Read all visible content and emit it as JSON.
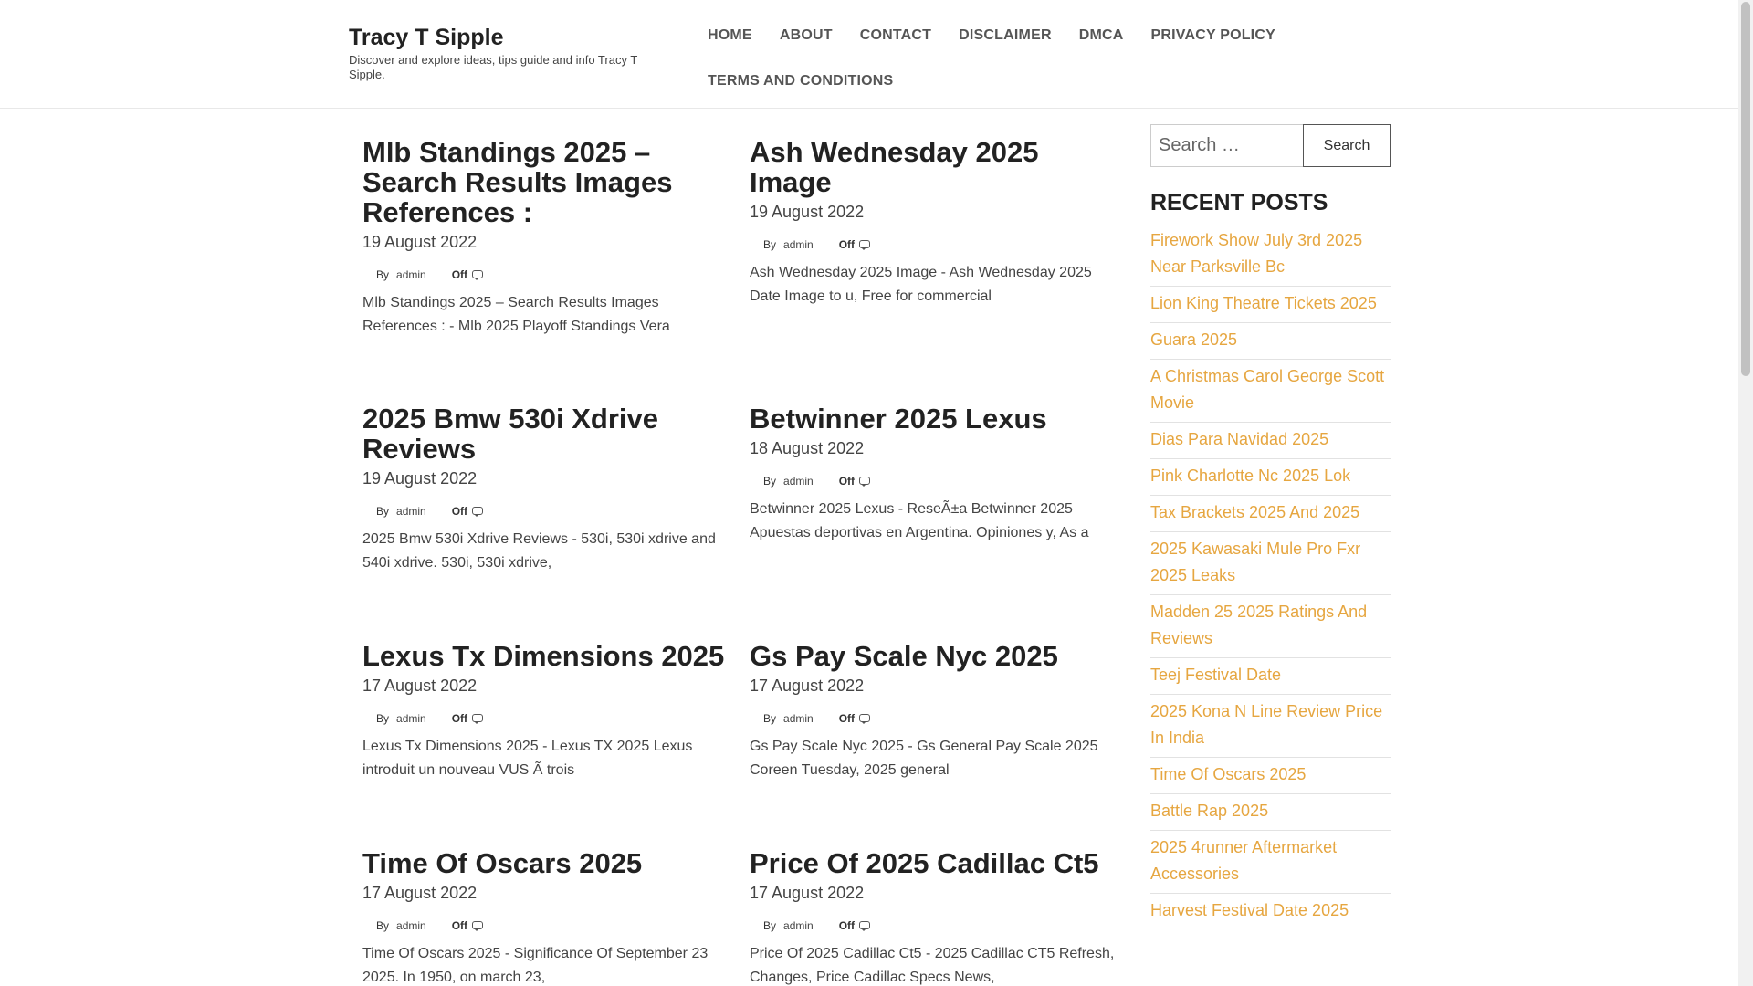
{
  "site": {
    "title": "Tracy T Sipple",
    "description": "Discover and explore ideas, tips guide and info Tracy T Sipple."
  },
  "nav": {
    "items": [
      "HOME",
      "ABOUT",
      "CONTACT",
      "DISCLAIMER",
      "DMCA",
      "PRIVACY POLICY",
      "TERMS AND CONDITIONS"
    ]
  },
  "posts": [
    {
      "title": "Mlb Standings 2025 – Search Results Images References :",
      "date": "19 August 2022",
      "by": "By",
      "author": "admin",
      "comments": "Off",
      "excerpt": "Mlb Standings 2025 – Search Results Images References : - Mlb 2025 Playoff Standings Vera"
    },
    {
      "title": "Ash Wednesday 2025 Image",
      "date": "19 August 2022",
      "by": "By",
      "author": "admin",
      "comments": "Off",
      "excerpt": "Ash Wednesday 2025 Image - Ash Wednesday 2025 Date Image to u, Free for commercial"
    },
    {
      "title": "2025 Bmw 530i Xdrive Reviews",
      "date": "19 August 2022",
      "by": "By",
      "author": "admin",
      "comments": "Off",
      "excerpt": "2025 Bmw 530i Xdrive Reviews - 530i, 530i xdrive and 540i xdrive. 530i, 530i xdrive,"
    },
    {
      "title": "Betwinner 2025 Lexus",
      "date": "18 August 2022",
      "by": "By",
      "author": "admin",
      "comments": "Off",
      "excerpt": "Betwinner 2025 Lexus - ReseÃ±a Betwinner 2025 Apuestas deportivas en Argentina. Opiniones y, As a"
    },
    {
      "title": "Lexus Tx Dimensions 2025",
      "date": "17 August 2022",
      "by": "By",
      "author": "admin",
      "comments": "Off",
      "excerpt": "Lexus Tx Dimensions 2025 - Lexus TX 2025 Lexus introduit un nouveau VUS Ã  trois"
    },
    {
      "title": "Gs Pay Scale Nyc 2025",
      "date": "17 August 2022",
      "by": "By",
      "author": "admin",
      "comments": "Off",
      "excerpt": "Gs Pay Scale Nyc 2025 - Gs General Pay Scale 2025 Coreen Tuesday, 2025 general"
    },
    {
      "title": "Time Of Oscars 2025",
      "date": "17 August 2022",
      "by": "By",
      "author": "admin",
      "comments": "Off",
      "excerpt": "Time Of Oscars 2025 - Significance Of September 23 2025. In 1950, on march 23,"
    },
    {
      "title": "Price Of 2025 Cadillac Ct5",
      "date": "17 August 2022",
      "by": "By",
      "author": "admin",
      "comments": "Off",
      "excerpt": "Price Of 2025 Cadillac Ct5 - 2025 Cadillac CT5 Refresh, Changes, Price Cadillac Specs News,"
    }
  ],
  "sidebar": {
    "search_placeholder": "Search …",
    "search_button": "Search",
    "recent_title": "RECENT POSTS",
    "recent_posts": [
      "Firework Show July 3rd 2025 Near Parksville Bc",
      "Lion King Theatre Tickets 2025",
      "Guara 2025",
      "A Christmas Carol George Scott Movie",
      "Dias Para Navidad 2025",
      "Pink Charlotte Nc 2025 Lok",
      "Tax Brackets 2025 And 2025",
      "2025 Kawasaki Mule Pro Fxr 2025 Leaks",
      "Madden 25 2025 Ratings And Reviews",
      "Teej Festival Date",
      "2025 Kona N Line Review Price In India",
      "Time Of Oscars 2025",
      "Battle Rap 2025",
      "2025 4runner Aftermarket Accessories",
      "Harvest Festival Date 2025"
    ],
    "link_color": "#e6a640"
  }
}
